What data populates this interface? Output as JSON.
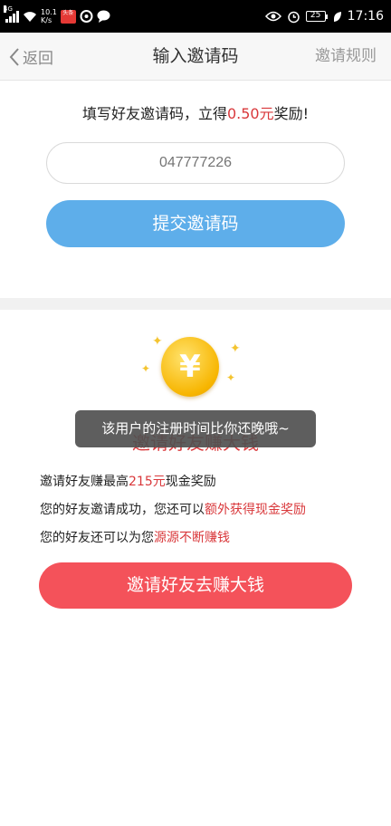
{
  "status_bar": {
    "network_type": "4G",
    "speed_value": "10.1",
    "speed_unit": "K/s",
    "app_badge": "头条",
    "battery_level": "25",
    "time": "17:16",
    "icons": [
      "signal-icon",
      "wifi-icon",
      "news-app-icon",
      "weibo-icon",
      "chat-icon",
      "eye-icon",
      "alarm-icon",
      "battery-icon",
      "leaf-icon"
    ]
  },
  "header": {
    "back_label": "返回",
    "title": "输入邀请码",
    "rules_label": "邀请规则"
  },
  "invite_form": {
    "prompt_prefix": "填写好友邀请码，立得",
    "prompt_amount": "0.50元",
    "prompt_suffix": "奖励!",
    "code_placeholder": "047777226",
    "submit_label": "提交邀请码"
  },
  "promo": {
    "coin_symbol": "¥",
    "title": "邀请好友赚大钱",
    "line1_prefix": "邀请好友赚最高",
    "line1_amount": "215元",
    "line1_suffix": "现金奖励",
    "line2_prefix": "您的好友邀请成功，您还可以",
    "line2_highlight": "额外获得现金奖励",
    "line3_prefix": "您的好友还可以为您",
    "line3_highlight": "源源不断赚钱",
    "invite_button_label": "邀请好友去赚大钱"
  },
  "toast": {
    "message": "该用户的注册时间比你还晚哦~"
  },
  "colors": {
    "accent_red": "#d9383b",
    "submit_blue": "#5eaeea",
    "invite_red": "#f4525a"
  }
}
